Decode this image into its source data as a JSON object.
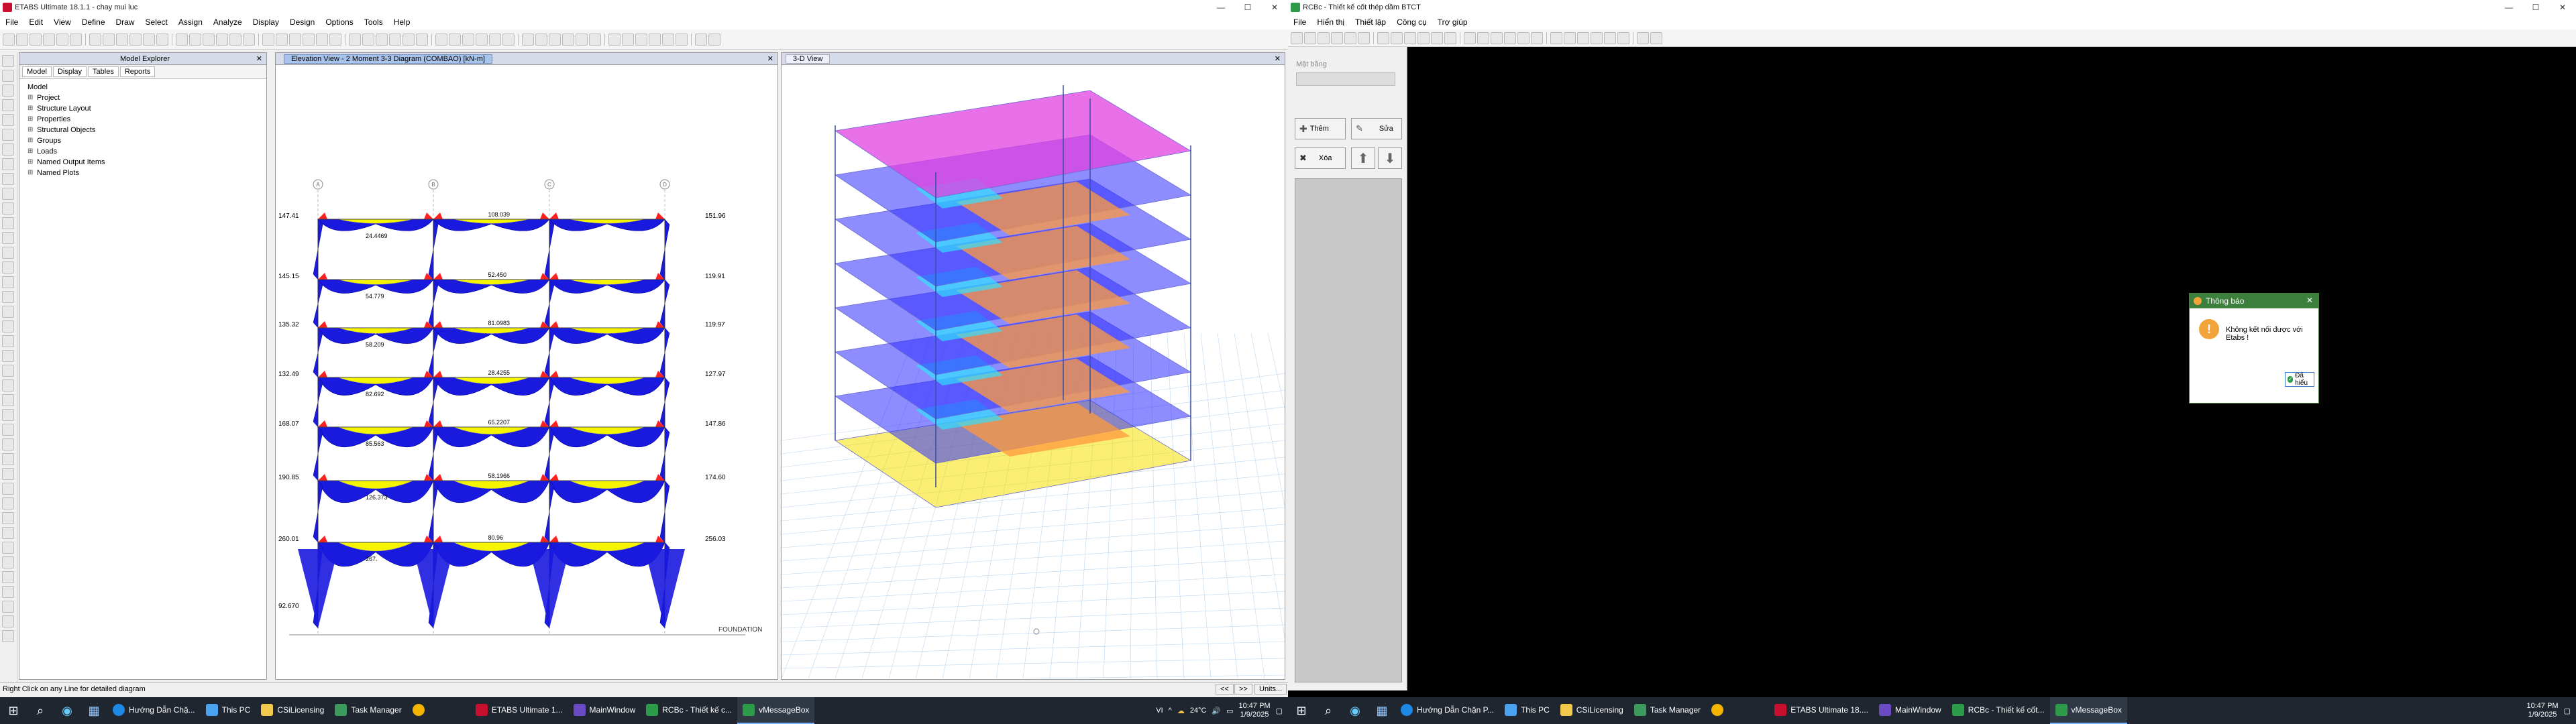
{
  "etabs": {
    "title": "ETABS Ultimate 18.1.1 - chay mui luc",
    "menu": [
      "File",
      "Edit",
      "View",
      "Define",
      "Draw",
      "Select",
      "Assign",
      "Analyze",
      "Display",
      "Design",
      "Options",
      "Tools",
      "Help"
    ],
    "explorer": {
      "header": "Model Explorer",
      "tabs": [
        "Model",
        "Display",
        "Tables",
        "Reports"
      ],
      "root": "Model",
      "items": [
        "Project",
        "Structure Layout",
        "Properties",
        "Structural Objects",
        "Groups",
        "Loads",
        "Named Output Items",
        "Named Plots"
      ]
    },
    "elevation": {
      "header": "Elevation View - 2   Moment 3-3 Diagram   (COMBAO)  [kN-m]",
      "foundation_label": "FOUNDATION",
      "left_values": [
        "147.41",
        "145.15",
        "135.32",
        "132.49",
        "168.07",
        "190.85",
        "260.01",
        "92.670"
      ],
      "right_values": [
        "151.96",
        "119.91",
        "119.97",
        "127.97",
        "147.86",
        "174.60",
        "256.03"
      ],
      "mid_values": [
        "24.4469",
        "54.779",
        "58.209",
        "82.692",
        "85.563",
        "126.373",
        "267.",
        "108.039",
        "52.450",
        "81.0983",
        "28.4255",
        "65.2207",
        "58.1966",
        "80.96"
      ],
      "col_labels": [
        "A",
        "B",
        "C",
        "D"
      ]
    },
    "view3d": {
      "header": "3-D View"
    },
    "status": {
      "left": "Right Click on any Line for detailed diagram",
      "units": "Units..."
    }
  },
  "rcbc": {
    "title": "RCBc - Thiết kế cốt thép dầm BTCT",
    "menu": [
      "File",
      "Hiển thị",
      "Thiết lập",
      "Công cụ",
      "Trợ giúp"
    ],
    "sidebar": {
      "label": "Mặt bằng",
      "add": "Thêm",
      "edit": "Sửa",
      "delete": "Xóa"
    },
    "dialog": {
      "title": "Thông báo",
      "message": "Không kết nối được với Etabs !",
      "ok": "Đã hiểu"
    }
  },
  "taskbar1": {
    "items": [
      "Hướng Dẫn Chặ...",
      "This PC",
      "CSiLicensing",
      "Task Manager",
      "ETABS Ultimate 1...",
      "MainWindow",
      "RCBc - Thiết kế c...",
      "vMessageBox"
    ],
    "lang": "VI",
    "temp": "24°C",
    "time": "10:47 PM",
    "date": "1/9/2025"
  },
  "taskbar2": {
    "items": [
      "Hướng Dẫn Chặn P...",
      "This PC",
      "CSiLicensing",
      "Task Manager",
      "ETABS Ultimate 18....",
      "MainWindow",
      "RCBc - Thiết kế cốt...",
      "vMessageBox"
    ],
    "time": "10:47 PM",
    "date": "1/9/2025"
  },
  "colors": {
    "dialog_header": "#3d7f3d",
    "moment_blue": "#1a1adf",
    "moment_yellow": "#f5f500",
    "moment_red": "#ff2020",
    "magenta": "#e040e0"
  }
}
